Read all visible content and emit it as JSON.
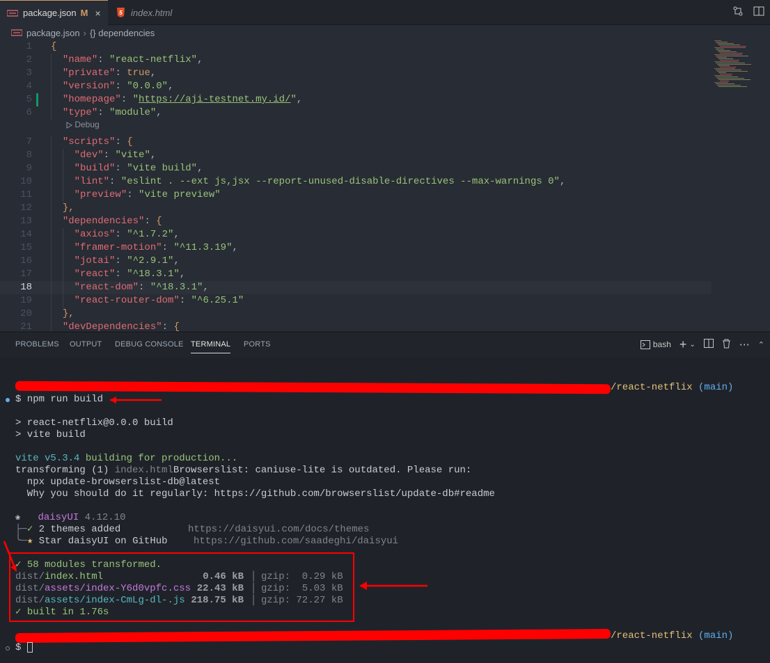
{
  "tabs": [
    {
      "label": "package.json",
      "modified": "M",
      "close": "×",
      "icon": "json-file-icon"
    },
    {
      "label": "index.html",
      "icon": "html5-file-icon"
    }
  ],
  "breadcrumb": {
    "file": "package.json",
    "sep": "›",
    "symbol": "{} dependencies"
  },
  "editor": {
    "current_line": 18,
    "codelens": "Debug",
    "lines": [
      {
        "n": "1",
        "html": "{"
      },
      {
        "n": "2",
        "key": "\"name\"",
        "val": "\"react-netflix\"",
        "tail": ",",
        "indent": 1
      },
      {
        "n": "3",
        "key": "\"private\"",
        "bool": "true",
        "tail": ",",
        "indent": 1
      },
      {
        "n": "4",
        "key": "\"version\"",
        "val": "\"0.0.0\"",
        "tail": ",",
        "indent": 1
      },
      {
        "n": "5",
        "key": "\"homepage\"",
        "url": "https://aji-testnet.my.id/",
        "tail": ",",
        "indent": 1
      },
      {
        "n": "6",
        "key": "\"type\"",
        "val": "\"module\"",
        "tail": ",",
        "indent": 1
      },
      {
        "n": "7",
        "key": "\"scripts\"",
        "brace": "{",
        "indent": 1
      },
      {
        "n": "8",
        "key": "\"dev\"",
        "val": "\"vite\"",
        "tail": ",",
        "indent": 2
      },
      {
        "n": "9",
        "key": "\"build\"",
        "val": "\"vite build\"",
        "tail": ",",
        "indent": 2
      },
      {
        "n": "10",
        "key": "\"lint\"",
        "val": "\"eslint . --ext js,jsx --report-unused-disable-directives --max-warnings 0\"",
        "tail": ",",
        "indent": 2
      },
      {
        "n": "11",
        "key": "\"preview\"",
        "val": "\"vite preview\"",
        "tail": "",
        "indent": 2
      },
      {
        "n": "12",
        "close": "},",
        "indent": 1
      },
      {
        "n": "13",
        "key": "\"dependencies\"",
        "brace": "{",
        "indent": 1
      },
      {
        "n": "14",
        "key": "\"axios\"",
        "val": "\"^1.7.2\"",
        "tail": ",",
        "indent": 2
      },
      {
        "n": "15",
        "key": "\"framer-motion\"",
        "val": "\"^11.3.19\"",
        "tail": ",",
        "indent": 2
      },
      {
        "n": "16",
        "key": "\"jotai\"",
        "val": "\"^2.9.1\"",
        "tail": ",",
        "indent": 2
      },
      {
        "n": "17",
        "key": "\"react\"",
        "val": "\"^18.3.1\"",
        "tail": ",",
        "indent": 2
      },
      {
        "n": "18",
        "key": "\"react-dom\"",
        "val": "\"^18.3.1\"",
        "tail": ",",
        "indent": 2
      },
      {
        "n": "19",
        "key": "\"react-router-dom\"",
        "val": "\"^6.25.1\"",
        "tail": "",
        "indent": 2
      },
      {
        "n": "20",
        "close": "},",
        "indent": 1
      },
      {
        "n": "21",
        "key": "\"devDependencies\"",
        "brace": "{",
        "indent": 1
      }
    ]
  },
  "panel": {
    "tabs": [
      "PROBLEMS",
      "OUTPUT",
      "DEBUG CONSOLE",
      "TERMINAL",
      "PORTS"
    ],
    "active_tab": "TERMINAL",
    "shell": "bash"
  },
  "terminal": {
    "prompt_suffix": "/react-netflix",
    "branch": "(main)",
    "command": "$ npm run build",
    "script_line1": "> react-netflix@0.0.0 build",
    "script_line2": "> vite build",
    "vite_version": "vite v5.3.4",
    "vite_building": " building for production...",
    "transform_prefix": "transforming (1) ",
    "transform_file": "index.html",
    "transform_msg": "Browserslist: caniuse-lite is outdated. Please run:",
    "npx_line": "  npx update-browserslist-db@latest",
    "why_line": "  Why you should do it regularly: https://github.com/browserslist/update-db#readme",
    "daisy_name": "daisyUI",
    "daisy_version": "4.12.10",
    "themes_label": "2 themes added",
    "themes_url": "https://daisyui.com/docs/themes",
    "star_label": "Star daisyUI on GitHub",
    "star_url": "https://github.com/saadeghi/daisyui",
    "modules": "✓ 58 modules transformed.",
    "files": [
      {
        "dir": "dist/",
        "name": "index.html",
        "size": "0.46 kB",
        "gzip": "gzip:  0.29 kB",
        "color": "#98c379"
      },
      {
        "dir": "dist/",
        "name": "assets/index-Y6d0vpfc.css",
        "size": "22.43 kB",
        "gzip": "gzip:  5.03 kB",
        "color": "#c678dd"
      },
      {
        "dir": "dist/",
        "name": "assets/index-CmLg-dl-.js",
        "size": "218.75 kB",
        "gzip": "gzip: 72.27 kB",
        "color": "#56b6c2"
      }
    ],
    "built": "✓ built in 1.76s",
    "final_prompt": "$"
  }
}
